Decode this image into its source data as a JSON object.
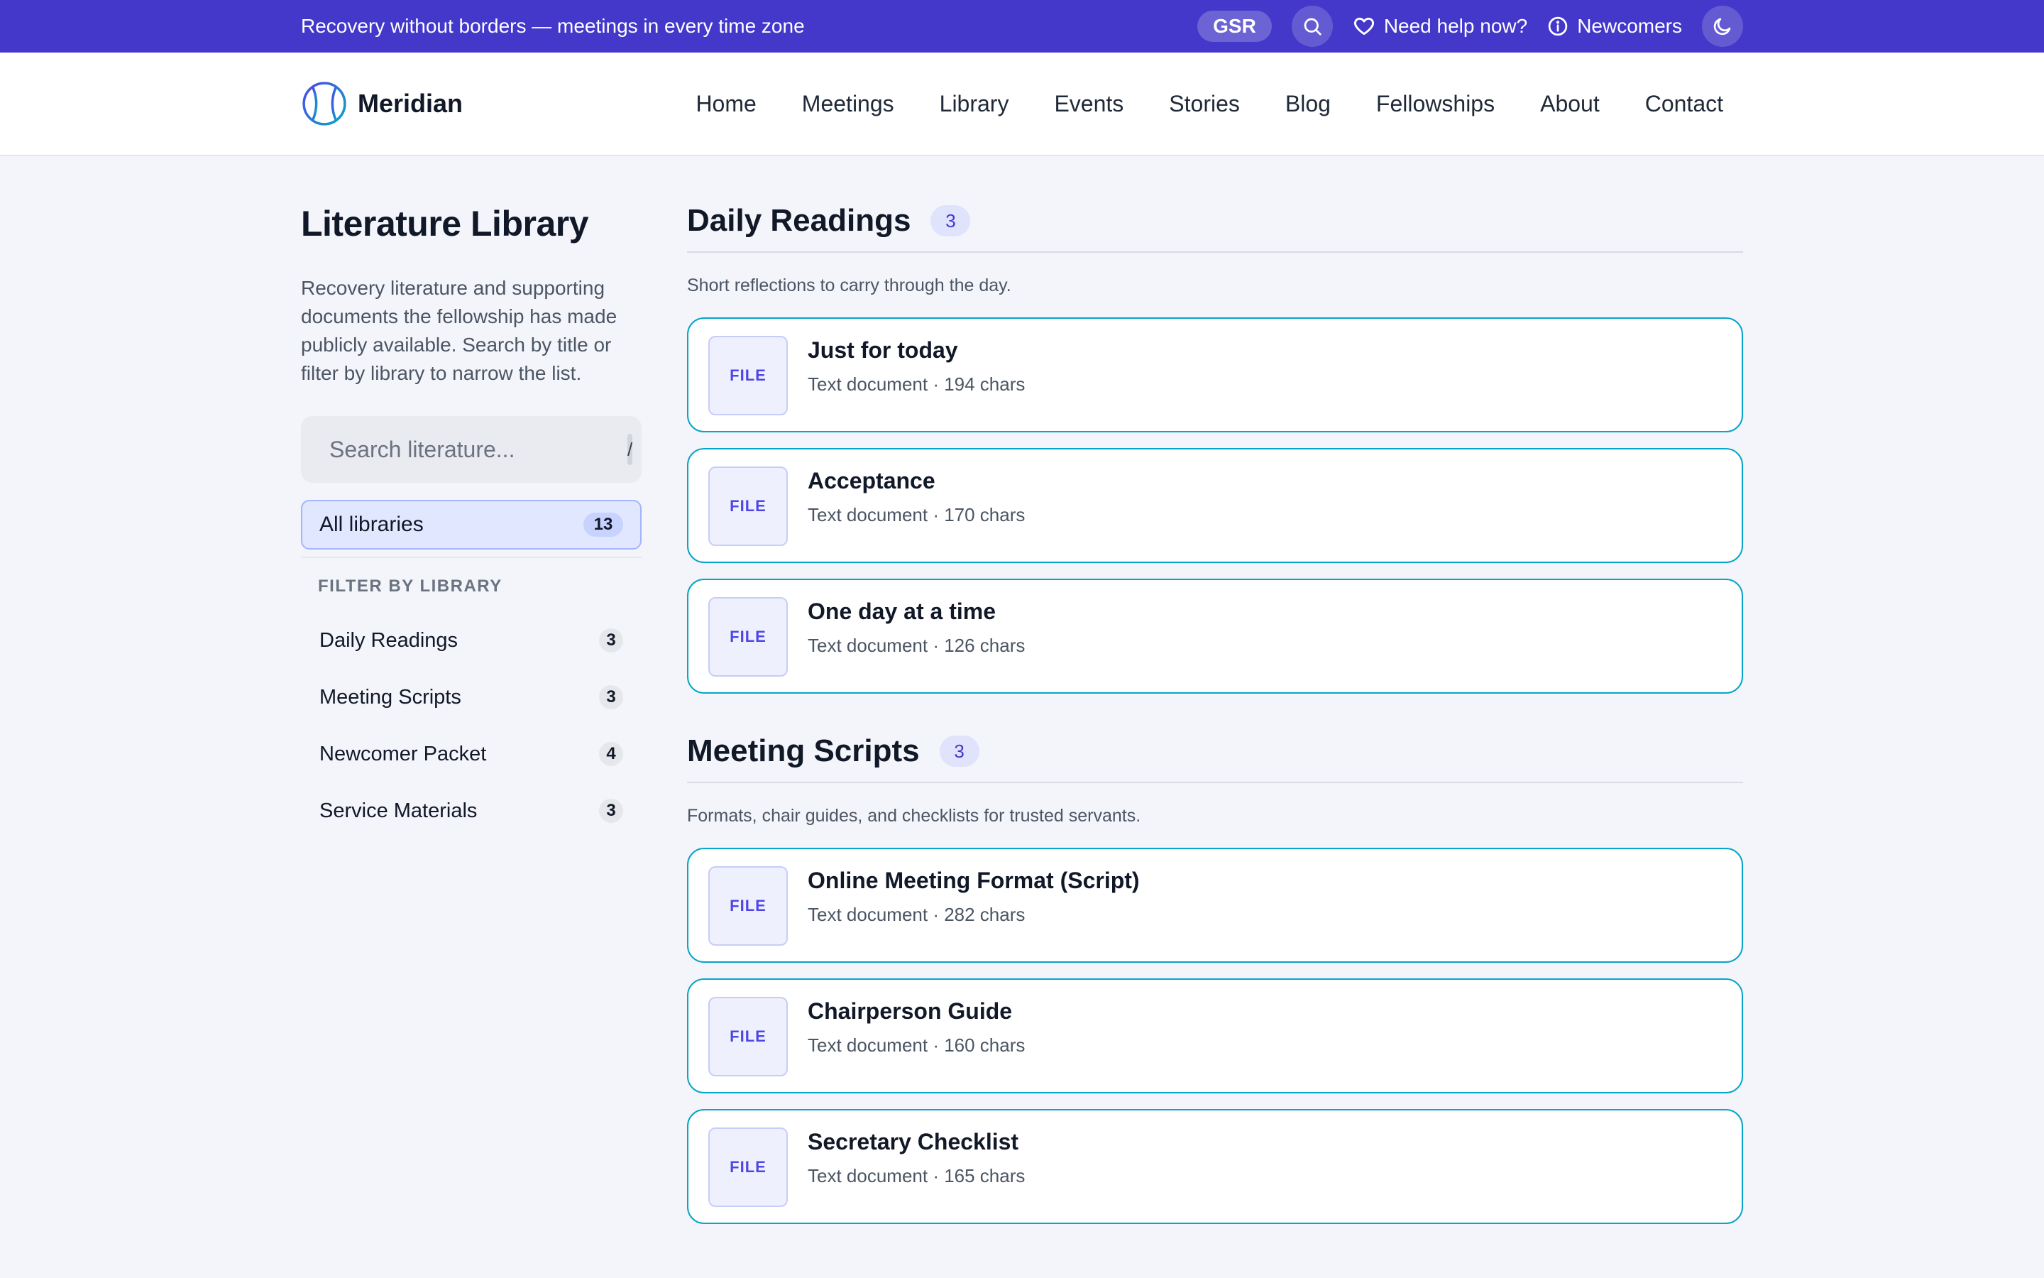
{
  "topbar": {
    "announcement": "Recovery without borders — meetings in every time zone",
    "gsr_label": "GSR",
    "help_label": "Need help now?",
    "newcomers_label": "Newcomers"
  },
  "header": {
    "brand": "Meridian",
    "nav": [
      "Home",
      "Meetings",
      "Library",
      "Events",
      "Stories",
      "Blog",
      "Fellowships",
      "About",
      "Contact"
    ]
  },
  "sidebar": {
    "title": "Literature Library",
    "description": "Recovery literature and supporting documents the fellowship has made publicly available. Search by title or filter by library to narrow the list.",
    "search_placeholder": "Search literature...",
    "search_shortcut": "/",
    "all_label": "All libraries",
    "all_count": "13",
    "filter_heading": "FILTER BY LIBRARY",
    "filters": [
      {
        "label": "Daily Readings",
        "count": "3"
      },
      {
        "label": "Meeting Scripts",
        "count": "3"
      },
      {
        "label": "Newcomer Packet",
        "count": "4"
      },
      {
        "label": "Service Materials",
        "count": "3"
      }
    ]
  },
  "sections": [
    {
      "title": "Daily Readings",
      "count": "3",
      "description": "Short reflections to carry through the day.",
      "files": [
        {
          "thumb": "FILE",
          "title": "Just for today",
          "meta": "Text document · 194 chars"
        },
        {
          "thumb": "FILE",
          "title": "Acceptance",
          "meta": "Text document · 170 chars"
        },
        {
          "thumb": "FILE",
          "title": "One day at a time",
          "meta": "Text document · 126 chars"
        }
      ]
    },
    {
      "title": "Meeting Scripts",
      "count": "3",
      "description": "Formats, chair guides, and checklists for trusted servants.",
      "files": [
        {
          "thumb": "FILE",
          "title": "Online Meeting Format (Script)",
          "meta": "Text document · 282 chars"
        },
        {
          "thumb": "FILE",
          "title": "Chairperson Guide",
          "meta": "Text document · 160 chars"
        },
        {
          "thumb": "FILE",
          "title": "Secretary Checklist",
          "meta": "Text document · 165 chars"
        }
      ]
    }
  ],
  "colors": {
    "topbar": "#4338ca",
    "accent": "#4f46e5",
    "card_border": "#06a5c9",
    "page_bg": "#f3f5fb"
  },
  "icons": [
    "globe-logo-icon",
    "search-icon",
    "heart-icon",
    "info-icon",
    "moon-icon",
    "file-icon"
  ]
}
